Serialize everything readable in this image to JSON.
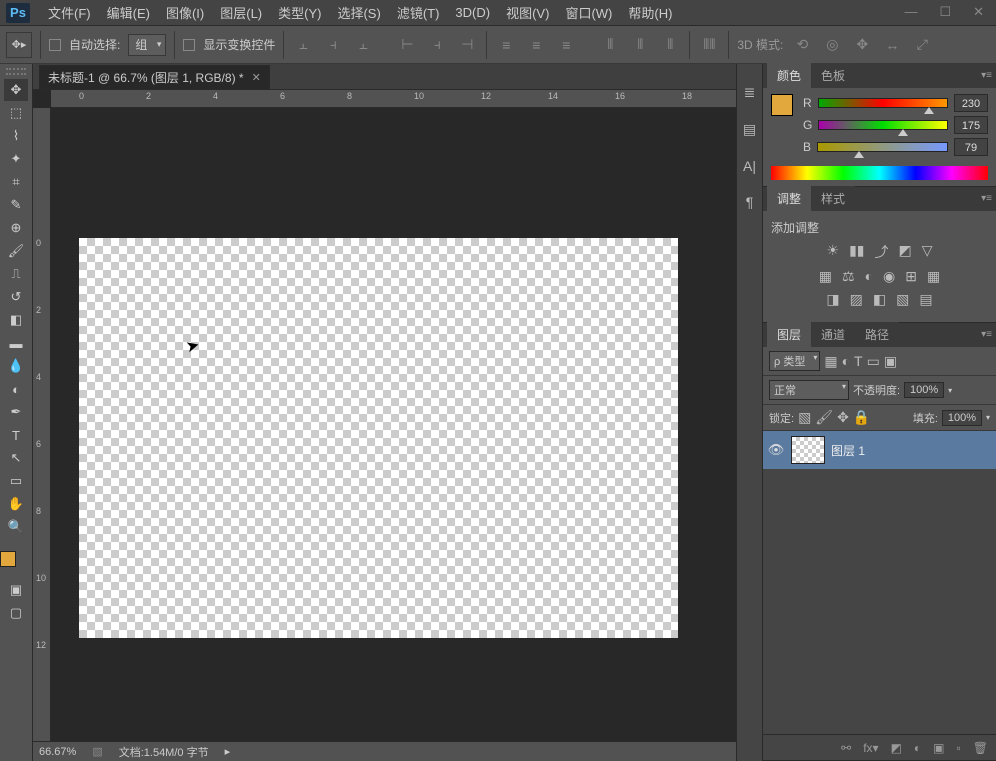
{
  "menu": {
    "file": "文件(F)",
    "edit": "编辑(E)",
    "image": "图像(I)",
    "layer": "图层(L)",
    "type": "类型(Y)",
    "select": "选择(S)",
    "filter": "滤镜(T)",
    "threeD": "3D(D)",
    "view": "视图(V)",
    "window": "窗口(W)",
    "help": "帮助(H)"
  },
  "optbar": {
    "autoSelect": "自动选择:",
    "group": "组",
    "showTransform": "显示变换控件",
    "mode3d": "3D 模式:"
  },
  "doc": {
    "tab": "未标题-1 @ 66.7% (图层 1, RGB/8) *",
    "zoom": "66.67%",
    "docinfo": "文档:1.54M/0 字节"
  },
  "rulerH": [
    "0",
    "2",
    "4",
    "6",
    "8",
    "10",
    "12",
    "14",
    "16",
    "18"
  ],
  "rulerV": [
    "0",
    "2",
    "4",
    "6",
    "8",
    "10",
    "12"
  ],
  "colorPanel": {
    "tab1": "颜色",
    "tab2": "色板",
    "r": "R",
    "g": "G",
    "b": "B",
    "rv": "230",
    "gv": "175",
    "bv": "79"
  },
  "adjPanel": {
    "tab1": "调整",
    "tab2": "样式",
    "title": "添加调整"
  },
  "layerPanel": {
    "tab1": "图层",
    "tab2": "通道",
    "tab3": "路径",
    "kind": "ρ 类型",
    "blend": "正常",
    "opacityLbl": "不透明度:",
    "opacity": "100%",
    "lockLbl": "锁定:",
    "fillLbl": "填充:",
    "fill": "100%",
    "layer1": "图层 1"
  }
}
